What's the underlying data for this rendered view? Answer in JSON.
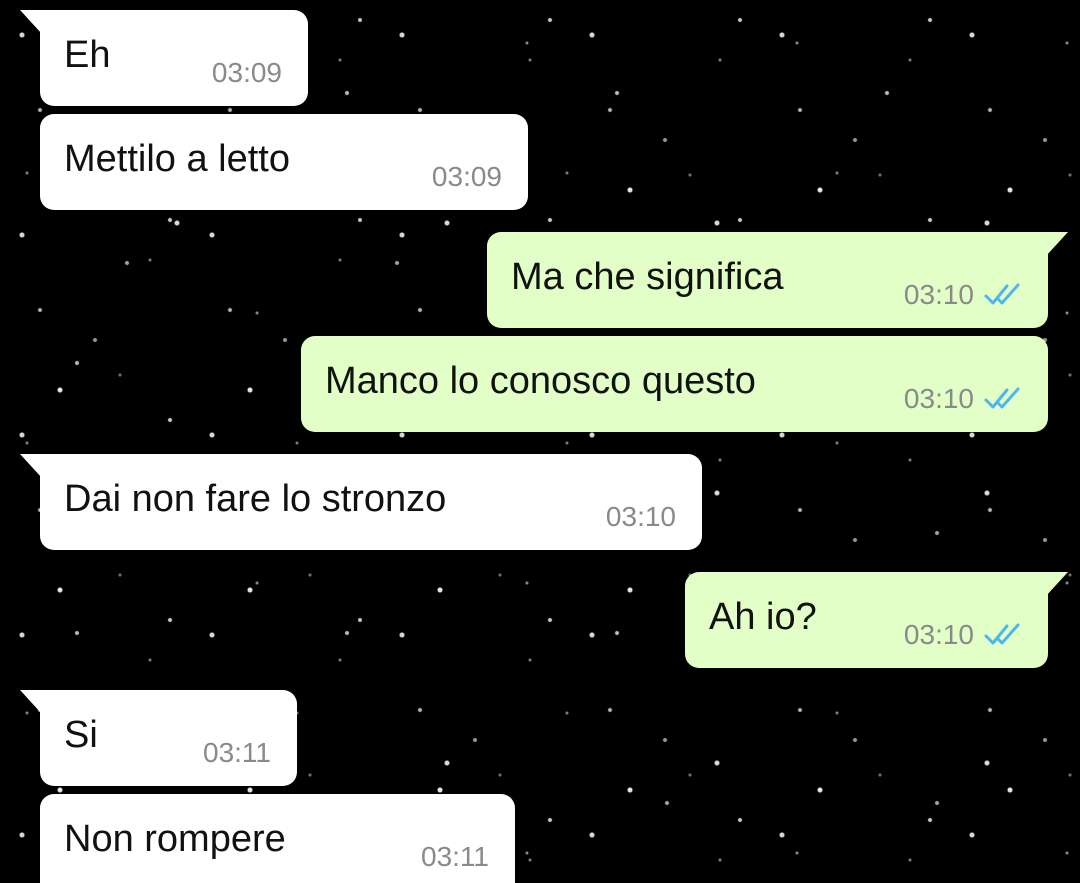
{
  "colors": {
    "background": "#000000",
    "incoming_bubble": "#ffffff",
    "outgoing_bubble": "#e2ffc7",
    "timestamp": "#8a8a8a",
    "read_ticks": "#4fb6ec"
  },
  "messages": [
    {
      "direction": "incoming",
      "text": "Eh",
      "time": "03:09"
    },
    {
      "direction": "incoming",
      "text": "Mettilo a letto",
      "time": "03:09"
    },
    {
      "direction": "outgoing",
      "text": "Ma che significa",
      "time": "03:10",
      "status_icon": "double-check-read-icon"
    },
    {
      "direction": "outgoing",
      "text": "Manco lo conosco questo",
      "time": "03:10",
      "status_icon": "double-check-read-icon"
    },
    {
      "direction": "incoming",
      "text": "Dai non fare lo stronzo",
      "time": "03:10"
    },
    {
      "direction": "outgoing",
      "text": "Ah io?",
      "time": "03:10",
      "status_icon": "double-check-read-icon"
    },
    {
      "direction": "incoming",
      "text": "Si",
      "time": "03:11"
    },
    {
      "direction": "incoming",
      "text": "Non rompere",
      "time": "03:11"
    }
  ]
}
